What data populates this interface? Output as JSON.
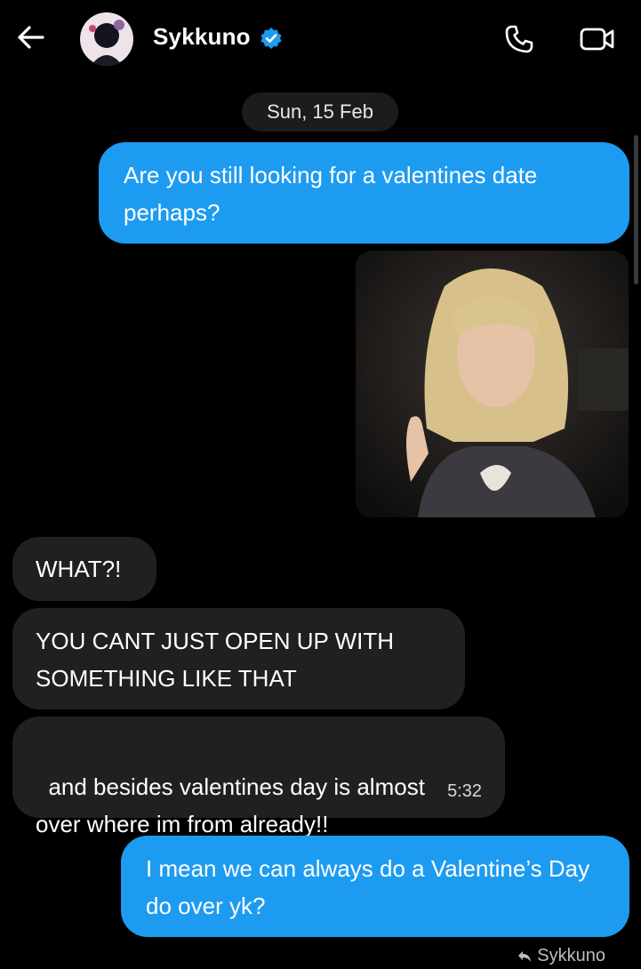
{
  "header": {
    "contact_name": "Sykkuno",
    "icons": {
      "back": "arrow-left-icon",
      "verified": "verified-badge-icon",
      "call": "phone-icon",
      "video": "video-camera-icon"
    }
  },
  "colors": {
    "sent_bubble": "#1d9bf0",
    "received_bubble": "#202023",
    "verified_badge": "#1d9bf0",
    "background": "#000000"
  },
  "conversation": {
    "date_label": "Sun, 15 Feb",
    "messages": [
      {
        "direction": "sent",
        "text": "Are you still looking for a valentines date perhaps?"
      },
      {
        "direction": "sent",
        "type": "gif"
      },
      {
        "direction": "received",
        "text": "WHAT?!"
      },
      {
        "direction": "received",
        "text": "YOU CANT JUST OPEN UP WITH SOMETHING LIKE THAT"
      },
      {
        "direction": "received",
        "text": "and besides valentines day is almost\nover where im from already!!",
        "time": "5:32"
      },
      {
        "direction": "sent",
        "text": "I mean we can always do a Valentine’s Day do over yk?"
      }
    ],
    "reply_hint": "Sykkuno"
  }
}
